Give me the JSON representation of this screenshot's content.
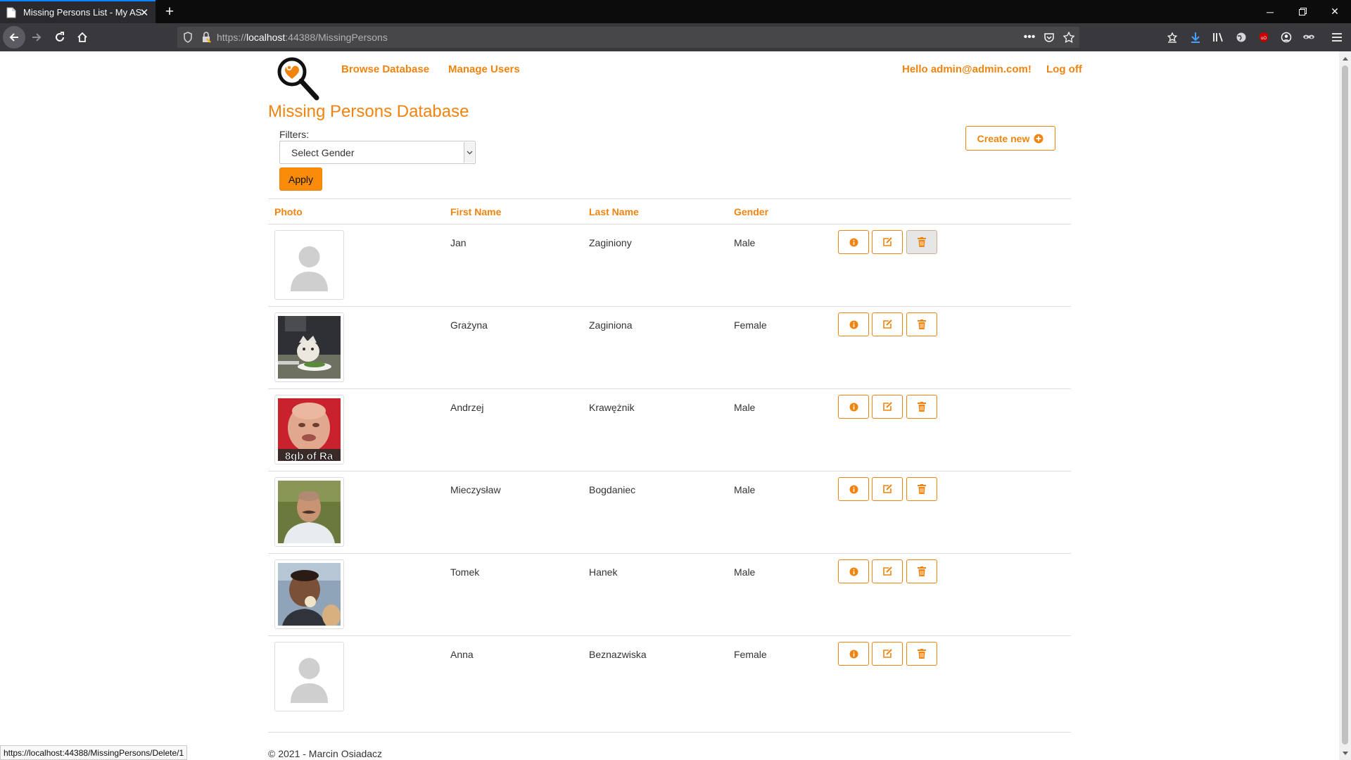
{
  "browser": {
    "tab_title": "Missing Persons List - My ASP.N",
    "url_prefix": "https://",
    "url_host": "localhost",
    "url_path": ":44388/MissingPersons",
    "status_url": "https://localhost:44388/MissingPersons/Delete/1"
  },
  "header": {
    "nav": [
      "Browse Database",
      "Manage Users"
    ],
    "greeting": "Hello admin@admin.com!",
    "logoff": "Log off"
  },
  "page": {
    "title": "Missing Persons Database",
    "filters_label": "Filters:",
    "gender_select": "Select Gender",
    "apply_label": "Apply",
    "create_label": "Create new"
  },
  "table": {
    "headers": [
      "Photo",
      "First Name",
      "Last Name",
      "Gender"
    ],
    "rows": [
      {
        "first": "Jan",
        "last": "Zaginiony",
        "gender": "Male",
        "photo": "placeholder-avatar"
      },
      {
        "first": "Grażyna",
        "last": "Zaginiona",
        "gender": "Female",
        "photo": "cat-at-dinner-photo"
      },
      {
        "first": "Andrzej",
        "last": "Krawężnik",
        "gender": "Male",
        "photo": "bald-man-red-background-photo"
      },
      {
        "first": "Mieczysław",
        "last": "Bogdaniec",
        "gender": "Male",
        "photo": "man-with-mustache-photo"
      },
      {
        "first": "Tomek",
        "last": "Hanek",
        "gender": "Male",
        "photo": "man-eating-ice-cream-photo"
      },
      {
        "first": "Anna",
        "last": "Beznazwiska",
        "gender": "Female",
        "photo": "placeholder-avatar"
      }
    ],
    "photo_caption_row3": "8gb of Ra"
  },
  "footer": {
    "text": "© 2021 - Marcin Osiadacz"
  },
  "colors": {
    "accent": "#f0840f",
    "apply_bg": "#fb8c0a",
    "chrome_dark": "#0c0c0d",
    "toolbar": "#38383d"
  }
}
